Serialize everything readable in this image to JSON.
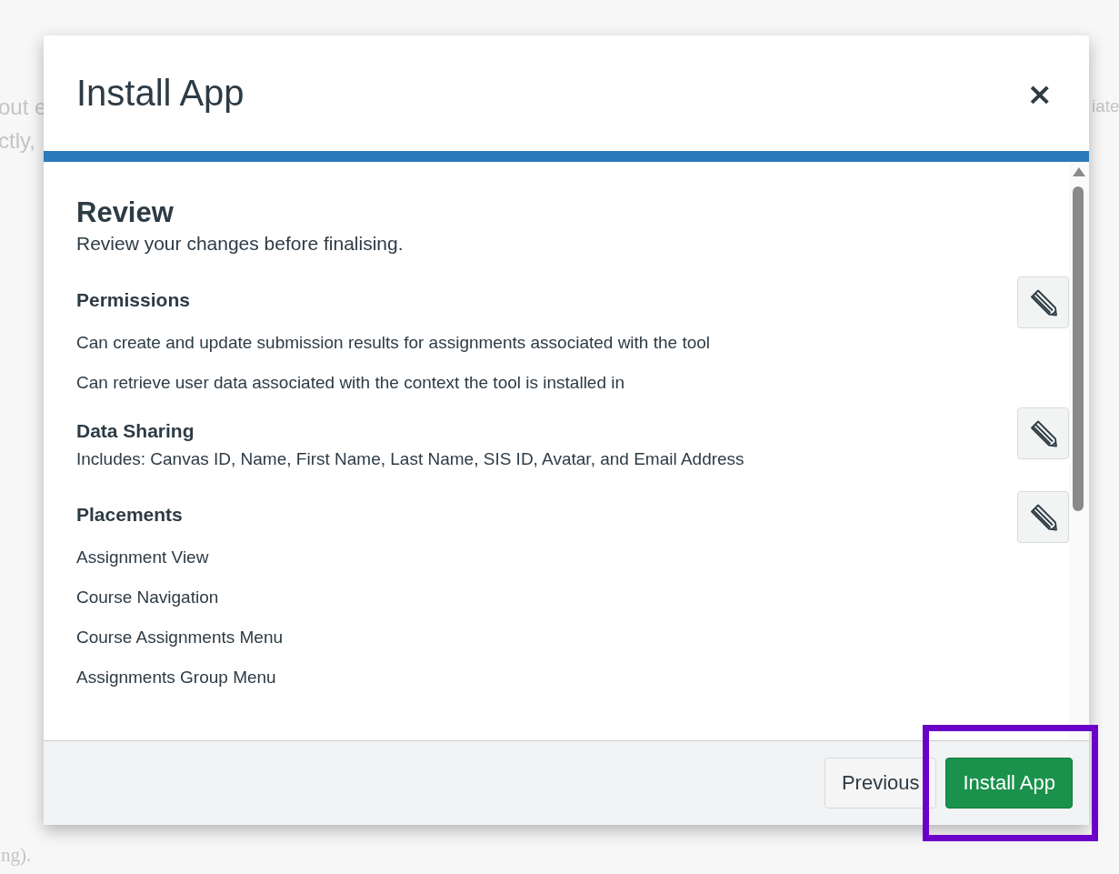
{
  "background_left": [
    "out e",
    "ctly,"
  ],
  "background_right": [
    "iate"
  ],
  "background_bottom": [
    "ng)."
  ],
  "modal": {
    "title": "Install App",
    "close": "×",
    "progress": {
      "level": 1
    },
    "heading": "Review",
    "subheading": "Review your changes before finalising.",
    "sections": [
      {
        "title": "Permissions",
        "items": [
          "Can create and update submission results for assignments associated with the tool",
          "Can retrieve user data associated with the context the tool is installed in"
        ]
      },
      {
        "title": "Data Sharing",
        "description": "Includes: Canvas ID, Name, First Name, Last Name, SIS ID, Avatar, and Email Address"
      },
      {
        "title": "Placements",
        "items": [
          "Assignment View",
          "Course Navigation",
          "Course Assignments Menu",
          "Assignments Group Menu"
        ]
      }
    ],
    "buttons": [
      {
        "label": "Previous",
        "kind": "secondary",
        "highlighted": false
      },
      {
        "label": "Install App",
        "kind": "primary",
        "highlighted": true
      }
    ]
  }
}
